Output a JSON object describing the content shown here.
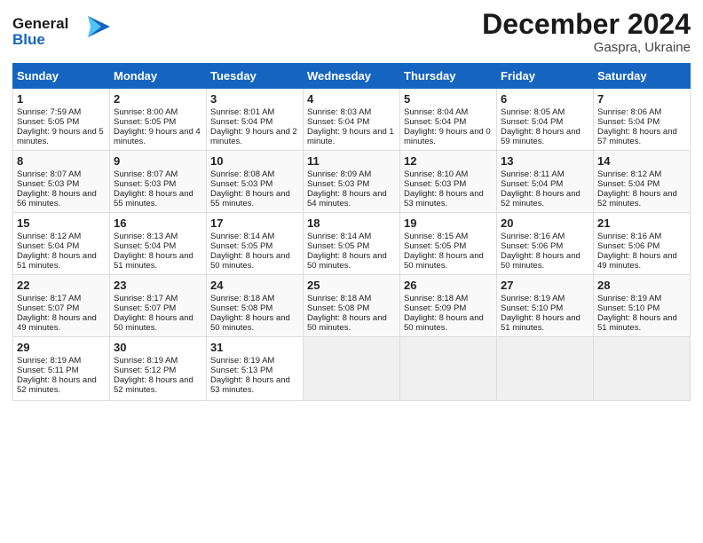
{
  "header": {
    "logo_line1": "General",
    "logo_line2": "Blue",
    "title": "December 2024",
    "subtitle": "Gaspra, Ukraine"
  },
  "days_of_week": [
    "Sunday",
    "Monday",
    "Tuesday",
    "Wednesday",
    "Thursday",
    "Friday",
    "Saturday"
  ],
  "weeks": [
    [
      {
        "day": 1,
        "sunrise": "Sunrise: 7:59 AM",
        "sunset": "Sunset: 5:05 PM",
        "daylight": "Daylight: 9 hours and 5 minutes."
      },
      {
        "day": 2,
        "sunrise": "Sunrise: 8:00 AM",
        "sunset": "Sunset: 5:05 PM",
        "daylight": "Daylight: 9 hours and 4 minutes."
      },
      {
        "day": 3,
        "sunrise": "Sunrise: 8:01 AM",
        "sunset": "Sunset: 5:04 PM",
        "daylight": "Daylight: 9 hours and 2 minutes."
      },
      {
        "day": 4,
        "sunrise": "Sunrise: 8:03 AM",
        "sunset": "Sunset: 5:04 PM",
        "daylight": "Daylight: 9 hours and 1 minute."
      },
      {
        "day": 5,
        "sunrise": "Sunrise: 8:04 AM",
        "sunset": "Sunset: 5:04 PM",
        "daylight": "Daylight: 9 hours and 0 minutes."
      },
      {
        "day": 6,
        "sunrise": "Sunrise: 8:05 AM",
        "sunset": "Sunset: 5:04 PM",
        "daylight": "Daylight: 8 hours and 59 minutes."
      },
      {
        "day": 7,
        "sunrise": "Sunrise: 8:06 AM",
        "sunset": "Sunset: 5:04 PM",
        "daylight": "Daylight: 8 hours and 57 minutes."
      }
    ],
    [
      {
        "day": 8,
        "sunrise": "Sunrise: 8:07 AM",
        "sunset": "Sunset: 5:03 PM",
        "daylight": "Daylight: 8 hours and 56 minutes."
      },
      {
        "day": 9,
        "sunrise": "Sunrise: 8:07 AM",
        "sunset": "Sunset: 5:03 PM",
        "daylight": "Daylight: 8 hours and 55 minutes."
      },
      {
        "day": 10,
        "sunrise": "Sunrise: 8:08 AM",
        "sunset": "Sunset: 5:03 PM",
        "daylight": "Daylight: 8 hours and 55 minutes."
      },
      {
        "day": 11,
        "sunrise": "Sunrise: 8:09 AM",
        "sunset": "Sunset: 5:03 PM",
        "daylight": "Daylight: 8 hours and 54 minutes."
      },
      {
        "day": 12,
        "sunrise": "Sunrise: 8:10 AM",
        "sunset": "Sunset: 5:03 PM",
        "daylight": "Daylight: 8 hours and 53 minutes."
      },
      {
        "day": 13,
        "sunrise": "Sunrise: 8:11 AM",
        "sunset": "Sunset: 5:04 PM",
        "daylight": "Daylight: 8 hours and 52 minutes."
      },
      {
        "day": 14,
        "sunrise": "Sunrise: 8:12 AM",
        "sunset": "Sunset: 5:04 PM",
        "daylight": "Daylight: 8 hours and 52 minutes."
      }
    ],
    [
      {
        "day": 15,
        "sunrise": "Sunrise: 8:12 AM",
        "sunset": "Sunset: 5:04 PM",
        "daylight": "Daylight: 8 hours and 51 minutes."
      },
      {
        "day": 16,
        "sunrise": "Sunrise: 8:13 AM",
        "sunset": "Sunset: 5:04 PM",
        "daylight": "Daylight: 8 hours and 51 minutes."
      },
      {
        "day": 17,
        "sunrise": "Sunrise: 8:14 AM",
        "sunset": "Sunset: 5:05 PM",
        "daylight": "Daylight: 8 hours and 50 minutes."
      },
      {
        "day": 18,
        "sunrise": "Sunrise: 8:14 AM",
        "sunset": "Sunset: 5:05 PM",
        "daylight": "Daylight: 8 hours and 50 minutes."
      },
      {
        "day": 19,
        "sunrise": "Sunrise: 8:15 AM",
        "sunset": "Sunset: 5:05 PM",
        "daylight": "Daylight: 8 hours and 50 minutes."
      },
      {
        "day": 20,
        "sunrise": "Sunrise: 8:16 AM",
        "sunset": "Sunset: 5:06 PM",
        "daylight": "Daylight: 8 hours and 50 minutes."
      },
      {
        "day": 21,
        "sunrise": "Sunrise: 8:16 AM",
        "sunset": "Sunset: 5:06 PM",
        "daylight": "Daylight: 8 hours and 49 minutes."
      }
    ],
    [
      {
        "day": 22,
        "sunrise": "Sunrise: 8:17 AM",
        "sunset": "Sunset: 5:07 PM",
        "daylight": "Daylight: 8 hours and 49 minutes."
      },
      {
        "day": 23,
        "sunrise": "Sunrise: 8:17 AM",
        "sunset": "Sunset: 5:07 PM",
        "daylight": "Daylight: 8 hours and 50 minutes."
      },
      {
        "day": 24,
        "sunrise": "Sunrise: 8:18 AM",
        "sunset": "Sunset: 5:08 PM",
        "daylight": "Daylight: 8 hours and 50 minutes."
      },
      {
        "day": 25,
        "sunrise": "Sunrise: 8:18 AM",
        "sunset": "Sunset: 5:08 PM",
        "daylight": "Daylight: 8 hours and 50 minutes."
      },
      {
        "day": 26,
        "sunrise": "Sunrise: 8:18 AM",
        "sunset": "Sunset: 5:09 PM",
        "daylight": "Daylight: 8 hours and 50 minutes."
      },
      {
        "day": 27,
        "sunrise": "Sunrise: 8:19 AM",
        "sunset": "Sunset: 5:10 PM",
        "daylight": "Daylight: 8 hours and 51 minutes."
      },
      {
        "day": 28,
        "sunrise": "Sunrise: 8:19 AM",
        "sunset": "Sunset: 5:10 PM",
        "daylight": "Daylight: 8 hours and 51 minutes."
      }
    ],
    [
      {
        "day": 29,
        "sunrise": "Sunrise: 8:19 AM",
        "sunset": "Sunset: 5:11 PM",
        "daylight": "Daylight: 8 hours and 52 minutes."
      },
      {
        "day": 30,
        "sunrise": "Sunrise: 8:19 AM",
        "sunset": "Sunset: 5:12 PM",
        "daylight": "Daylight: 8 hours and 52 minutes."
      },
      {
        "day": 31,
        "sunrise": "Sunrise: 8:19 AM",
        "sunset": "Sunset: 5:13 PM",
        "daylight": "Daylight: 8 hours and 53 minutes."
      },
      null,
      null,
      null,
      null
    ]
  ]
}
